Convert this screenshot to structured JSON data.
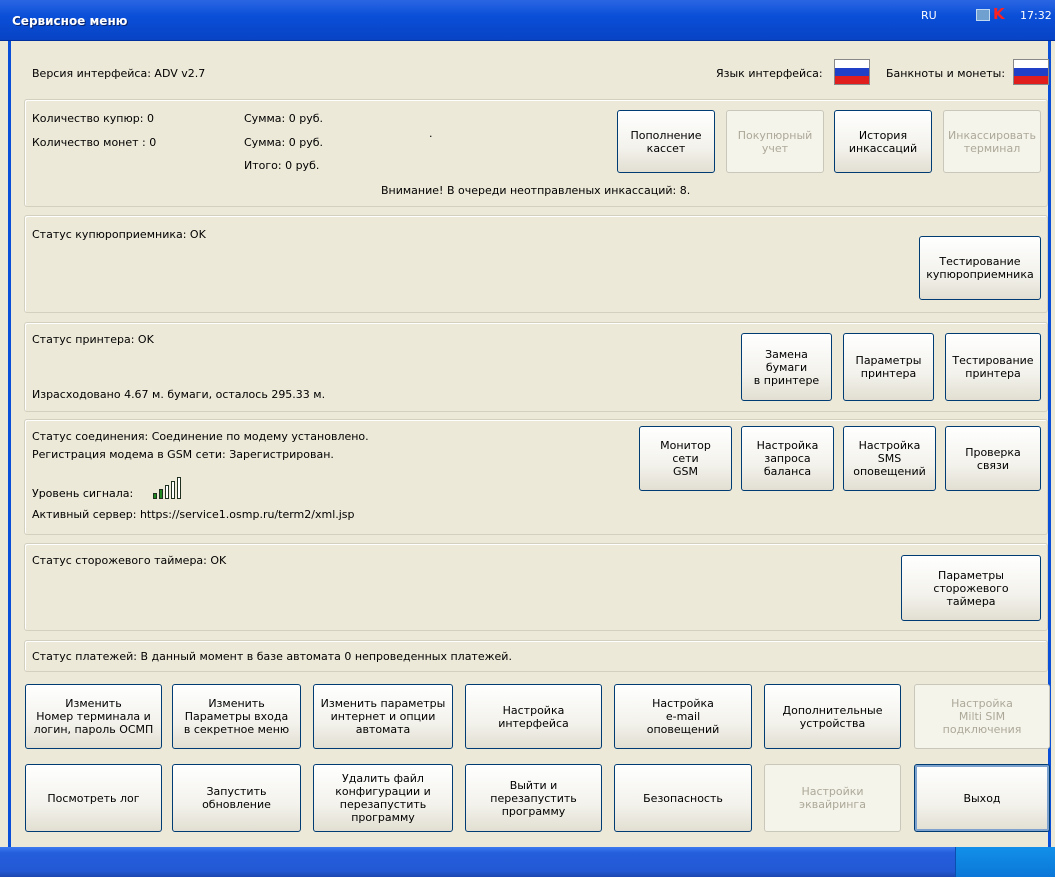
{
  "window": {
    "title": "Сервисное меню"
  },
  "header": {
    "version": "Версия интерфейса: ADV v2.7",
    "lang_label": "Язык интерфейса:",
    "money_label": "Банкноты и монеты:"
  },
  "cash": {
    "bills_count": "Количество купюр: 0",
    "coins_count": "Количество монет : 0",
    "sum1": "Сумма: 0 руб.",
    "sum2": "Сумма: 0 руб.",
    "total": "Итого: 0 руб.",
    "dot": ".",
    "warning": "Внимание! В очереди неотправленых инкассаций: 8.",
    "buttons": {
      "refill": "Пополнение\nкассет",
      "accounting": "Покупюрный\nучет",
      "history": "История\nинкассаций",
      "collect": "Инкассировать\nтерминал"
    }
  },
  "bill_acceptor": {
    "status": "Статус купюроприемника: OK",
    "test_button": "Тестирование\nкупюроприемника"
  },
  "printer": {
    "status": "Статус принтера: OK",
    "paper": "Израсходовано 4.67 м. бумаги, осталось 295.33 м.",
    "buttons": {
      "replace": "Замена\nбумаги\nв принтере",
      "params": "Параметры\nпринтера",
      "test": "Тестирование\nпринтера"
    }
  },
  "connection": {
    "status": "Статус соединения: Соединение по модему установлено.",
    "gsm_reg": "Регистрация модема в GSM сети: Зарегистрирован.",
    "signal_label": "Уровень сигнала:",
    "signal_level": 0.4,
    "server": "Активный сервер: https://service1.osmp.ru/term2/xml.jsp",
    "buttons": {
      "monitor": "Монитор\nсети\nGSM",
      "balance": "Настройка\nзапроса\nбаланса",
      "sms": "Настройка\nSMS\nоповещений",
      "check": "Проверка\nсвязи"
    }
  },
  "watchdog": {
    "status": "Статус сторожевого таймера: OK",
    "params_button": "Параметры\nсторожевого\nтаймера"
  },
  "payments": {
    "status": "Статус платежей: В данный момент в базе автомата 0 непроведенных платежей."
  },
  "bottom": {
    "row1": {
      "change_terminal": "Изменить\nНомер терминала и\nлогин, пароль ОСМП",
      "change_secret": "Изменить\nПараметры входа\nв секретное меню",
      "change_internet": "Изменить параметры\nинтернет и опции\nавтомата",
      "interface": "Настройка\nинтерфейса",
      "email": "Настройка\ne-mail\nоповещений",
      "devices": "Дополнительные\nустройства",
      "multisim": "Настройка\nMilti SIM\nподключения"
    },
    "row2": {
      "log": "Посмотреть лог",
      "update": "Запустить\nобновление",
      "delete_config": "Удалить файл\nконфигурации и\nперезапустить\nпрограмму",
      "restart": "Выйти и\nперезапустить\nпрограмму",
      "security": "Безопасность",
      "acquiring": "Настройки\nэквайринга",
      "exit": "Выход"
    }
  },
  "taskbar": {
    "lang": "RU",
    "clock": "17:32"
  },
  "colors": {
    "titlebar": "#0a4fd8",
    "disabled_text": "#aca899",
    "button_border": "#003c74"
  }
}
